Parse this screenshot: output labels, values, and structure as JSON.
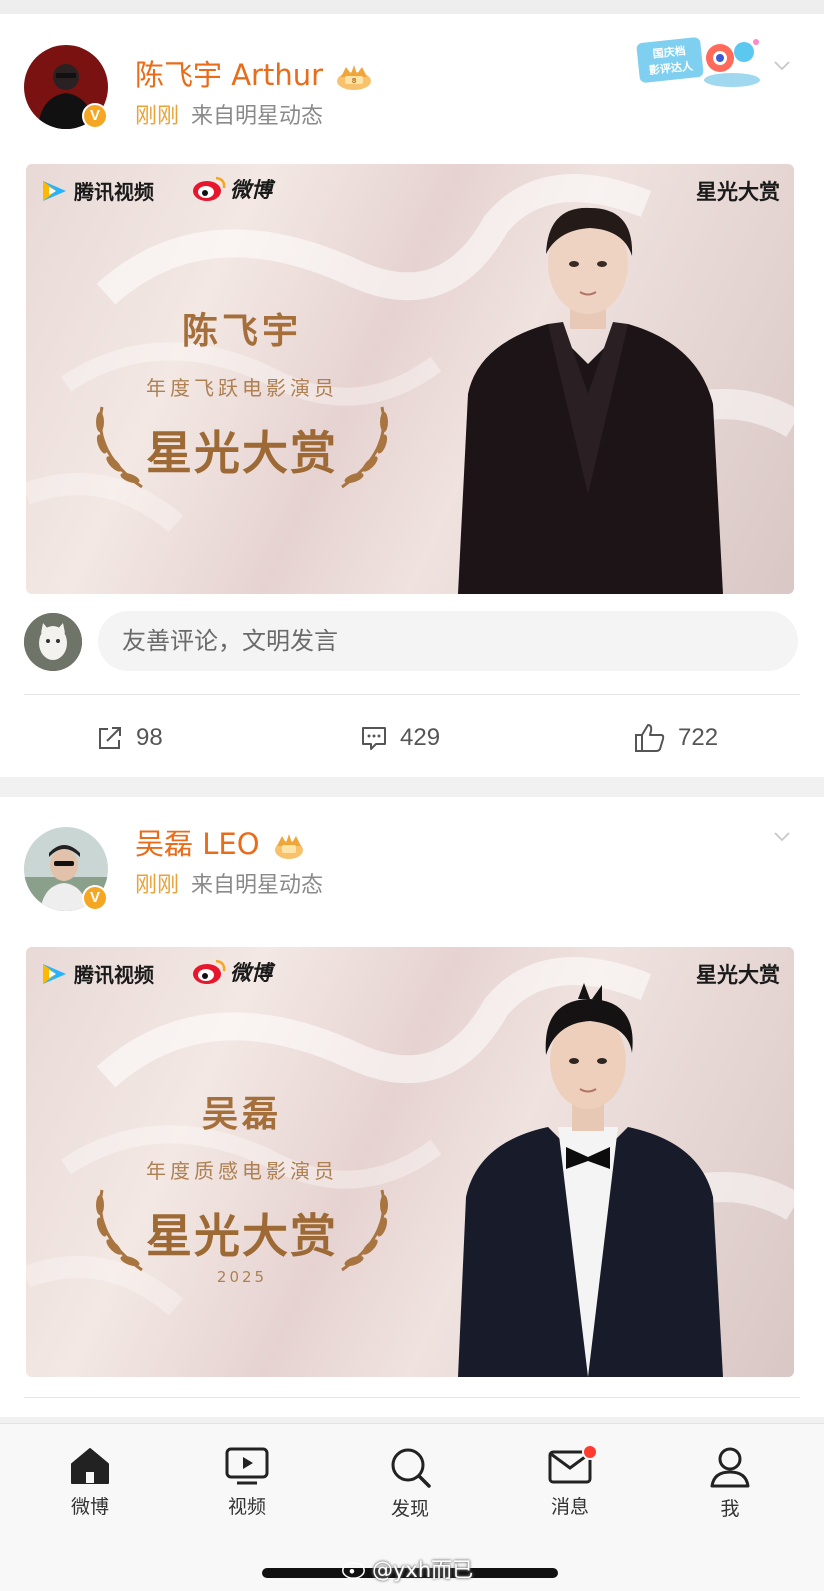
{
  "posts": [
    {
      "author": "陈飞宇 Arthur",
      "time": "刚刚",
      "source": "来自明星动态",
      "verified_badge": "V",
      "banner": {
        "platform_logo": "腾讯视频",
        "weibo_logo": "微博",
        "event_logo": "星光大赏",
        "star_name": "陈飞宇",
        "award_category": "年度飞跃电影演员",
        "award_title": "星光大赏",
        "year": ""
      },
      "comment_placeholder": "友善评论，文明发言",
      "reposts": "98",
      "comments": "429",
      "likes": "722"
    },
    {
      "author": "吴磊 LEO",
      "time": "刚刚",
      "source": "来自明星动态",
      "verified_badge": "V",
      "banner": {
        "platform_logo": "腾讯视频",
        "weibo_logo": "微博",
        "event_logo": "星光大赏",
        "star_name": "吴磊",
        "award_category": "年度质感电影演员",
        "award_title": "星光大赏",
        "year": "2025"
      }
    }
  ],
  "sticker": {
    "text": "国庆档影评达人"
  },
  "tabbar": {
    "tabs": [
      {
        "label": "微博",
        "icon": "home-icon",
        "active": true
      },
      {
        "label": "视频",
        "icon": "video-icon"
      },
      {
        "label": "发现",
        "icon": "search-icon"
      },
      {
        "label": "消息",
        "icon": "mail-icon",
        "badge": true
      },
      {
        "label": "我",
        "icon": "profile-icon"
      }
    ]
  },
  "watermark": "@yxh而已",
  "colors": {
    "accent_name": "#e86c19",
    "time": "#e8a33a",
    "badge": "#f5a623",
    "award_gold": "#a56f3c"
  }
}
